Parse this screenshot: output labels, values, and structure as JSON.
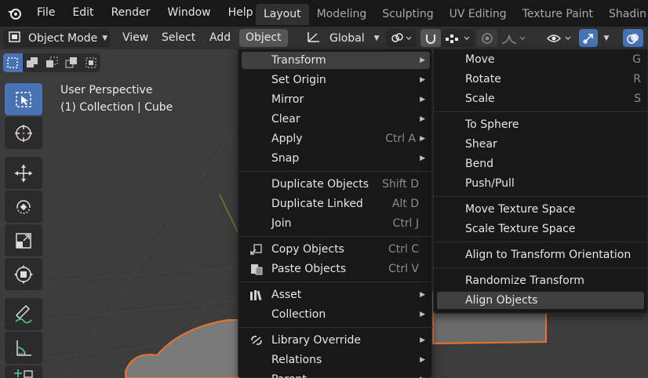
{
  "topbar": {
    "menus": [
      "File",
      "Edit",
      "Render",
      "Window",
      "Help"
    ],
    "workspaces": [
      "Layout",
      "Modeling",
      "Sculpting",
      "UV Editing",
      "Texture Paint",
      "Shadin"
    ]
  },
  "header": {
    "mode": "Object Mode",
    "menus": [
      "View",
      "Select",
      "Add",
      "Object"
    ],
    "orientation": "Global"
  },
  "viewport": {
    "line1": "User Perspective",
    "line2": "(1) Collection | Cube"
  },
  "object_menu": {
    "items": [
      {
        "label": "Transform",
        "shortcut": "",
        "submenu": true,
        "icon": ""
      },
      {
        "label": "Set Origin",
        "shortcut": "",
        "submenu": true,
        "icon": ""
      },
      {
        "label": "Mirror",
        "shortcut": "",
        "submenu": true,
        "icon": ""
      },
      {
        "label": "Clear",
        "shortcut": "",
        "submenu": true,
        "icon": ""
      },
      {
        "label": "Apply",
        "shortcut": "Ctrl A",
        "submenu": true,
        "icon": ""
      },
      {
        "label": "Snap",
        "shortcut": "",
        "submenu": true,
        "icon": ""
      },
      {
        "label": "Duplicate Objects",
        "shortcut": "Shift D",
        "submenu": false,
        "icon": ""
      },
      {
        "label": "Duplicate Linked",
        "shortcut": "Alt D",
        "submenu": false,
        "icon": ""
      },
      {
        "label": "Join",
        "shortcut": "Ctrl J",
        "submenu": false,
        "icon": ""
      },
      {
        "label": "Copy Objects",
        "shortcut": "Ctrl C",
        "submenu": false,
        "icon": "copy-icon"
      },
      {
        "label": "Paste Objects",
        "shortcut": "Ctrl V",
        "submenu": false,
        "icon": "paste-icon"
      },
      {
        "label": "Asset",
        "shortcut": "",
        "submenu": true,
        "icon": "asset-icon"
      },
      {
        "label": "Collection",
        "shortcut": "",
        "submenu": true,
        "icon": ""
      },
      {
        "label": "Library Override",
        "shortcut": "",
        "submenu": true,
        "icon": "library-override-icon"
      },
      {
        "label": "Relations",
        "shortcut": "",
        "submenu": true,
        "icon": ""
      },
      {
        "label": "Parent",
        "shortcut": "",
        "submenu": true,
        "icon": ""
      }
    ]
  },
  "transform_menu": {
    "items": [
      {
        "label": "Move",
        "shortcut": "G"
      },
      {
        "label": "Rotate",
        "shortcut": "R"
      },
      {
        "label": "Scale",
        "shortcut": "S"
      },
      {
        "label": "To Sphere",
        "shortcut": ""
      },
      {
        "label": "Shear",
        "shortcut": ""
      },
      {
        "label": "Bend",
        "shortcut": ""
      },
      {
        "label": "Push/Pull",
        "shortcut": ""
      },
      {
        "label": "Move Texture Space",
        "shortcut": ""
      },
      {
        "label": "Scale Texture Space",
        "shortcut": ""
      },
      {
        "label": "Align to Transform Orientation",
        "shortcut": ""
      },
      {
        "label": "Randomize Transform",
        "shortcut": ""
      },
      {
        "label": "Align Objects",
        "shortcut": ""
      }
    ]
  },
  "colors": {
    "accent": "#4772b3",
    "menu_bg": "#181818",
    "viewport_bg": "#3c3c3c",
    "selection_outline": "#e8742c"
  }
}
